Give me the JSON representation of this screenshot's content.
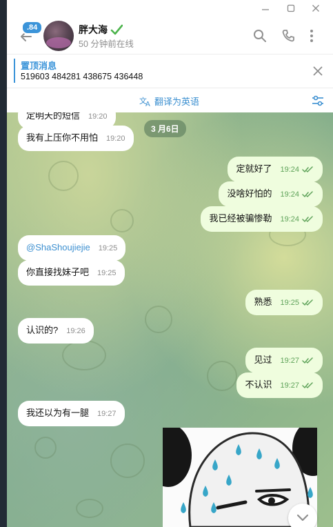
{
  "header": {
    "unread_count": ".84",
    "contact_name": "胖大海",
    "last_seen": "50 分钟前在线"
  },
  "pinned": {
    "title": "置顶消息",
    "text": "519603 484281 438675 436448"
  },
  "translate": {
    "label": "翻译为英语"
  },
  "chat": {
    "date_separator": "3 月6日",
    "messages": [
      {
        "text": "定明天的短信",
        "time": "19:20",
        "dir": "in"
      },
      {
        "text": "我有上压你不用怕",
        "time": "19:20",
        "dir": "in"
      },
      {
        "text": "定就好了",
        "time": "19:24",
        "dir": "out"
      },
      {
        "text": "没啥好怕的",
        "time": "19:24",
        "dir": "out"
      },
      {
        "text": "我已经被骗惨勒",
        "time": "19:24",
        "dir": "out"
      },
      {
        "text": "@ShaShoujiejie",
        "time": "19:25",
        "dir": "in"
      },
      {
        "text": "你直接找妹子吧",
        "time": "19:25",
        "dir": "in"
      },
      {
        "text": "熟悉",
        "time": "19:25",
        "dir": "out"
      },
      {
        "text": "认识的?",
        "time": "19:26",
        "dir": "in"
      },
      {
        "text": "见过",
        "time": "19:27",
        "dir": "out"
      },
      {
        "text": "不认识",
        "time": "19:27",
        "dir": "out"
      },
      {
        "text": "我还以为有一腿",
        "time": "19:27",
        "dir": "in"
      }
    ]
  },
  "colors": {
    "accent": "#3b94d9",
    "outgoing_bubble": "#effdde",
    "incoming_bubble": "#ffffff",
    "check_green": "#5fa35a"
  },
  "icons": [
    "minimize-icon",
    "maximize-icon",
    "close-icon",
    "back-arrow-icon",
    "verified-icon",
    "search-icon",
    "phone-icon",
    "more-icon",
    "translate-icon",
    "settings-sliders-icon",
    "double-check-icon",
    "chevron-down-icon"
  ]
}
